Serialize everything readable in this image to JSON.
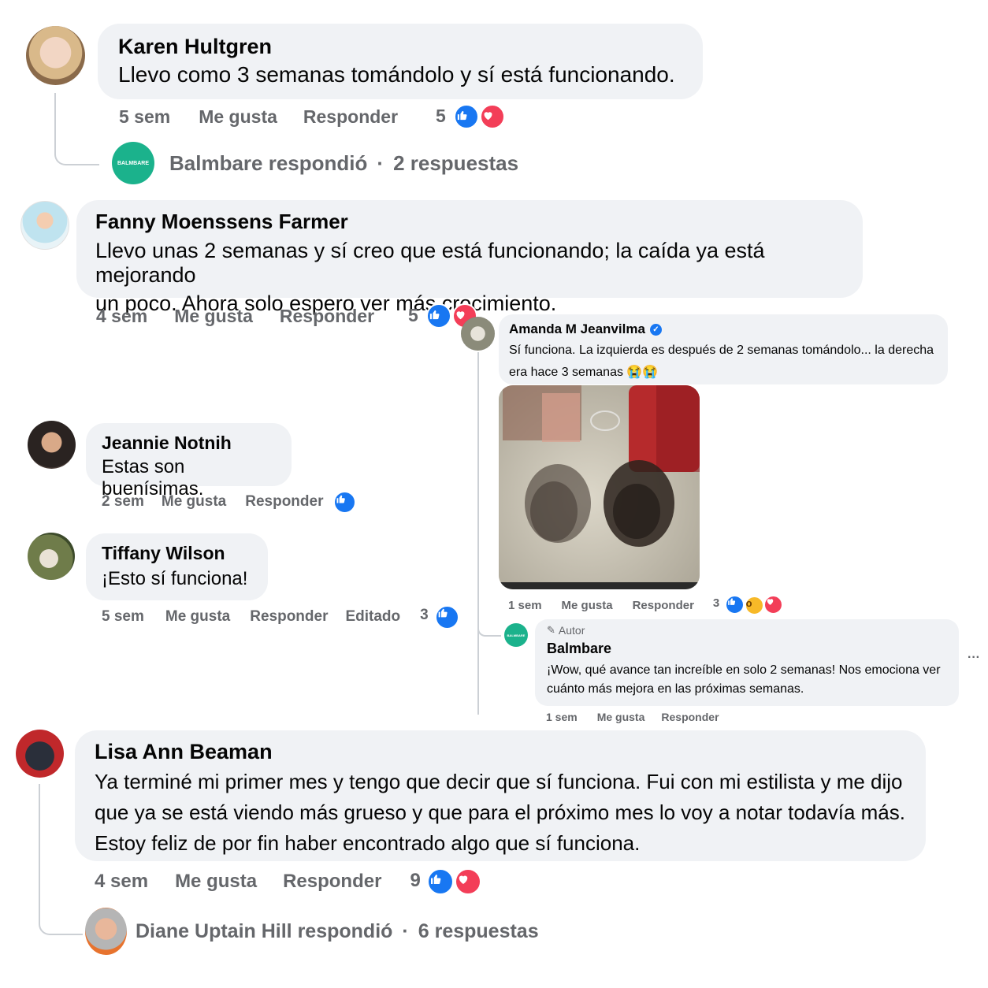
{
  "comments": {
    "c1": {
      "name": "Karen Hultgren",
      "text": "Llevo como 3 semanas tomándolo y sí está funcionando.",
      "time": "5 sem",
      "like": "Me gusta",
      "reply": "Responder",
      "reaction_count": "5",
      "replies": {
        "author": "Balmbare respondió",
        "sep": "·",
        "count": "2 respuestas",
        "logo": "BALMBARE"
      }
    },
    "c2": {
      "name": "Fanny Moenssens Farmer",
      "text1": "Llevo unas 2 semanas y sí creo que está funcionando; la caída ya está mejorando",
      "text2": "un poco. Ahora solo espero ver más crecimiento.",
      "time": "4 sem",
      "like": "Me gusta",
      "reply": "Responder",
      "reaction_count": "5"
    },
    "c3": {
      "name": "Jeannie Notnih",
      "text": "Estas son buenísimas.",
      "time": "2 sem",
      "like": "Me gusta",
      "reply": "Responder"
    },
    "c4": {
      "name": "Tiffany Wilson",
      "text": "¡Esto sí funciona!",
      "time": "5 sem",
      "like": "Me gusta",
      "reply": "Responder",
      "edited": "Editado",
      "reaction_count": "3"
    },
    "c5": {
      "name": "Amanda M Jeanvilma",
      "text1": "Sí funciona. La izquierda es después de 2 semanas tomándolo... la derecha",
      "text2": "era hace 3 semanas 😭😭",
      "time": "1 sem",
      "like": "Me gusta",
      "reply": "Responder",
      "reaction_count": "3",
      "reply_comment": {
        "badge": "Autor",
        "name": "Balmbare",
        "logo": "BALMBARE",
        "text1": "¡Wow, qué avance tan increíble en solo 2 semanas! Nos emociona ver",
        "text2": "cuánto más mejora en las próximas semanas.",
        "time": "1 sem",
        "like": "Me gusta",
        "reply": "Responder",
        "more": "···"
      }
    },
    "c6": {
      "name": "Lisa Ann Beaman",
      "text1": "Ya terminé mi primer mes y tengo que decir que sí funciona. Fui con mi estilista y me dijo",
      "text2": "que ya se está viendo más grueso y que para el próximo mes lo voy a notar todavía más.",
      "text3": "Estoy feliz de por fin haber encontrado algo que sí funciona.",
      "time": "4 sem",
      "like": "Me gusta",
      "reply": "Responder",
      "reaction_count": "9",
      "replies": {
        "author": "Diane Uptain Hill respondió",
        "sep": "·",
        "count": "6 respuestas"
      }
    }
  },
  "colors": {
    "bubble": "#f0f2f5",
    "meta": "#65676b",
    "like": "#1877f2",
    "love": "#f33e58",
    "brand": "#1bb28c",
    "verified": "#1877f2"
  },
  "icons": {
    "like": "thumbs-up-icon",
    "love": "heart-icon",
    "wow": "wow-face-icon",
    "verified": "verified-badge-icon",
    "pencil": "pencil-icon"
  }
}
